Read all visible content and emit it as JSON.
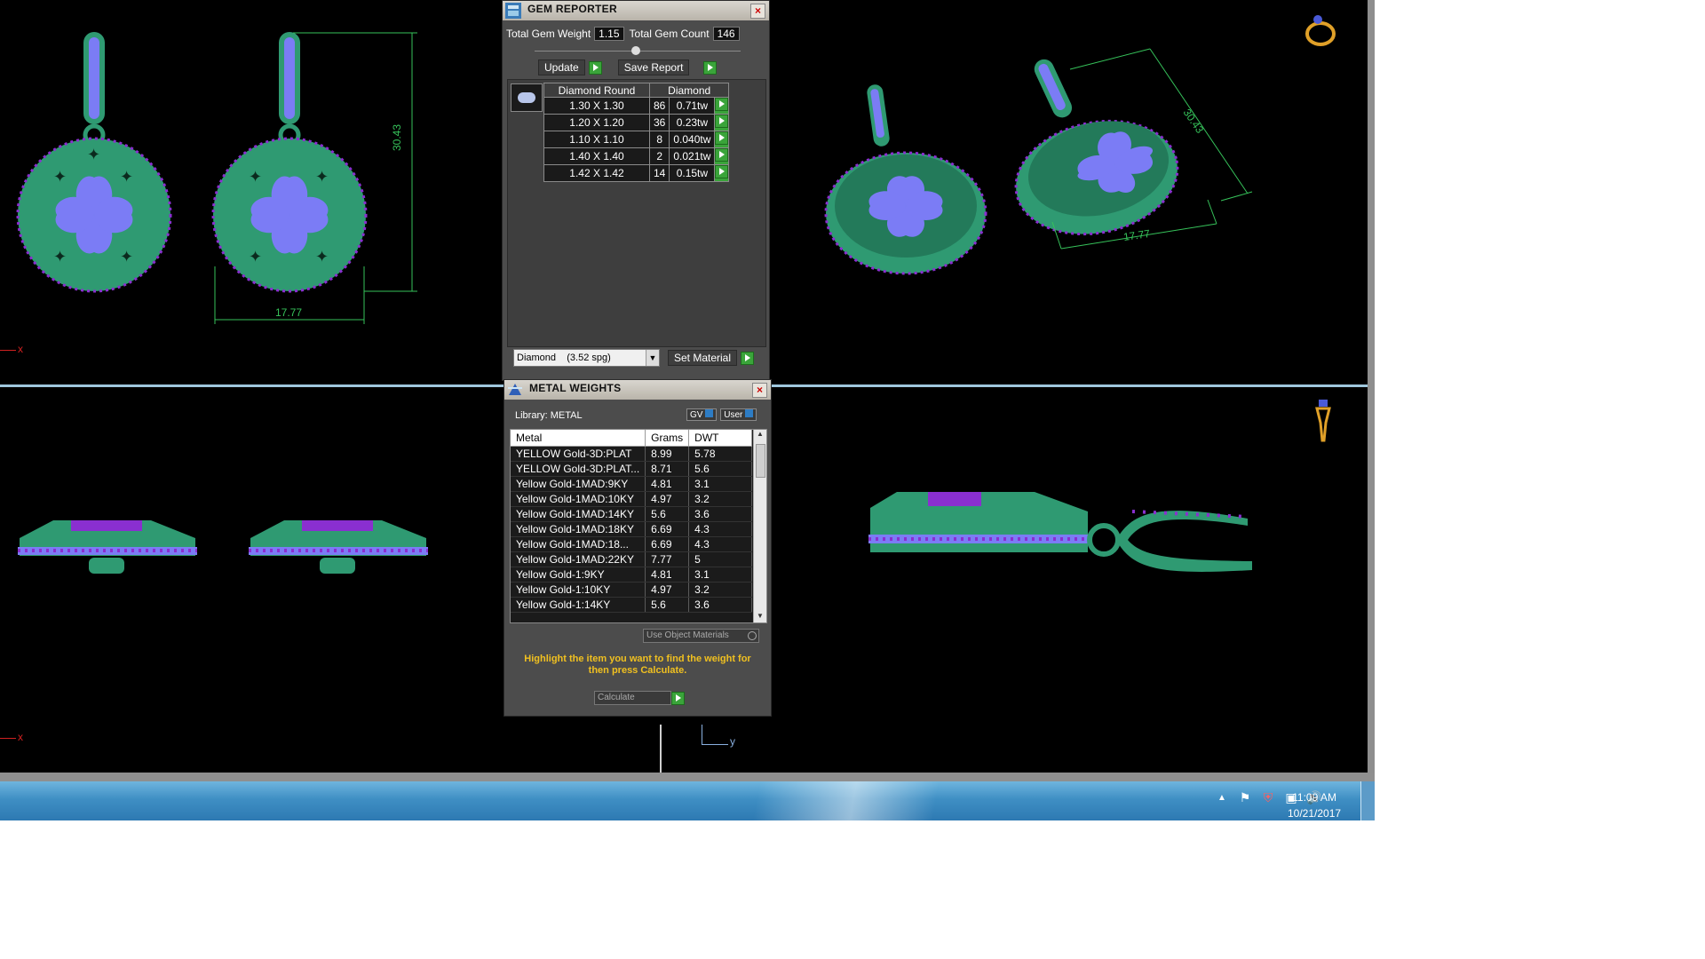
{
  "gem_reporter": {
    "title": "GEM REPORTER",
    "total_weight_label": "Total Gem Weight",
    "total_weight_value": "1.15",
    "total_count_label": "Total Gem Count",
    "total_count_value": "146",
    "update_label": "Update",
    "save_report_label": "Save Report",
    "table_headers": [
      "Diamond Round",
      "Diamond"
    ],
    "rows": [
      {
        "size": "1.30 X 1.30",
        "count": "86",
        "weight": "0.71tw"
      },
      {
        "size": "1.20 X 1.20",
        "count": "36",
        "weight": "0.23tw"
      },
      {
        "size": "1.10 X 1.10",
        "count": "8",
        "weight": "0.040tw"
      },
      {
        "size": "1.40 X 1.40",
        "count": "2",
        "weight": "0.021tw"
      },
      {
        "size": "1.42 X 1.42",
        "count": "14",
        "weight": "0.15tw"
      }
    ],
    "material_select": "Diamond    (3.52 spg)",
    "set_material_label": "Set Material"
  },
  "metal_weights": {
    "title": "METAL WEIGHTS",
    "library_label": "Library: METAL",
    "gv_label": "GV",
    "user_label": "User",
    "headers": [
      "Metal",
      "Grams",
      "DWT"
    ],
    "rows": [
      {
        "metal": "YELLOW Gold-3D:PLAT",
        "grams": "8.99",
        "dwt": "5.78"
      },
      {
        "metal": "YELLOW Gold-3D:PLAT...",
        "grams": "8.71",
        "dwt": "5.6"
      },
      {
        "metal": "Yellow Gold-1MAD:9KY",
        "grams": "4.81",
        "dwt": "3.1"
      },
      {
        "metal": "Yellow Gold-1MAD:10KY",
        "grams": "4.97",
        "dwt": "3.2"
      },
      {
        "metal": "Yellow Gold-1MAD:14KY",
        "grams": "5.6",
        "dwt": "3.6"
      },
      {
        "metal": "Yellow Gold-1MAD:18KY",
        "grams": "6.69",
        "dwt": "4.3"
      },
      {
        "metal": "Yellow Gold-1MAD:18...",
        "grams": "6.69",
        "dwt": "4.3"
      },
      {
        "metal": "Yellow Gold-1MAD:22KY",
        "grams": "7.77",
        "dwt": "5"
      },
      {
        "metal": "Yellow Gold-1:9KY",
        "grams": "4.81",
        "dwt": "3.1"
      },
      {
        "metal": "Yellow Gold-1:10KY",
        "grams": "4.97",
        "dwt": "3.2"
      },
      {
        "metal": "Yellow Gold-1:14KY",
        "grams": "5.6",
        "dwt": "3.6"
      }
    ],
    "use_object_materials": "Use Object Materials",
    "instruction": "Highlight the item you want to find the weight for then press Calculate.",
    "calculate_label": "Calculate"
  },
  "viewports": {
    "front_dim_height": "30.43",
    "front_dim_width": "17.77",
    "persp_dim_height": "30.43",
    "persp_dim_width": "17.77",
    "axis_x_label": "x",
    "axis_y_label": "y"
  },
  "taskbar": {
    "time": "11:09 AM",
    "date": "10/21/2017"
  },
  "colors": {
    "metal_green": "#2f9a72",
    "gem_blue": "#7b7cf5",
    "gem_purple": "#8a2fd0",
    "dim_line": "#36c25a"
  }
}
